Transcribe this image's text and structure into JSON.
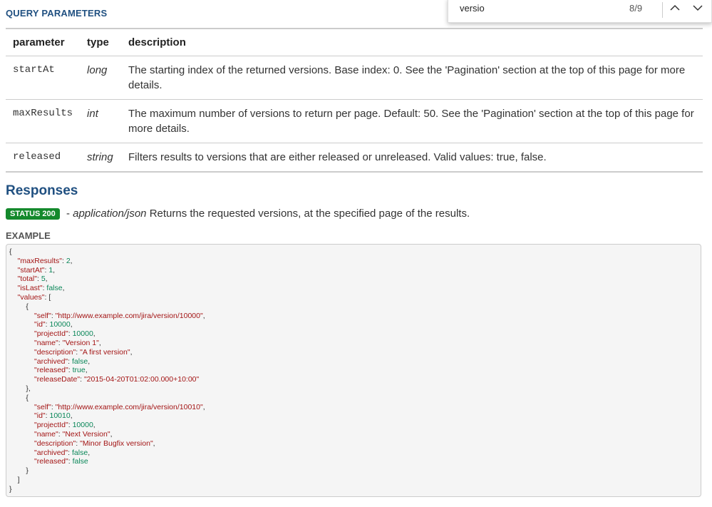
{
  "query_parameters": {
    "title": "QUERY PARAMETERS",
    "headers": {
      "parameter": "parameter",
      "type": "type",
      "description": "description"
    },
    "rows": [
      {
        "name": "startAt",
        "type": "long",
        "description": "The starting index of the returned versions. Base index: 0. See the 'Pagination' section at the top of this page for more details."
      },
      {
        "name": "maxResults",
        "type": "int",
        "description": "The maximum number of versions to return per page. Default: 50. See the 'Pagination' section at the top of this page for more details."
      },
      {
        "name": "released",
        "type": "string",
        "description": "Filters results to versions that are either released or unreleased. Valid values: true, false."
      }
    ]
  },
  "responses": {
    "title": "Responses",
    "status_badge": "STATUS 200",
    "separator": " - ",
    "mime": "application/json",
    "description": " Returns the requested versions, at the specified page of the results.",
    "example_label": "EXAMPLE"
  },
  "example_json": {
    "maxResults": 2,
    "startAt": 1,
    "total": 5,
    "isLast": false,
    "values": [
      {
        "self": "http://www.example.com/jira/version/10000",
        "id": 10000,
        "projectId": 10000,
        "name": "Version 1",
        "description": "A first version",
        "archived": false,
        "released": true,
        "releaseDate": "2015-04-20T01:02:00.000+10:00"
      },
      {
        "self": "http://www.example.com/jira/version/10010",
        "id": 10010,
        "projectId": 10000,
        "name": "Next Version",
        "description": "Minor Bugfix version",
        "archived": false,
        "released": false
      }
    ]
  },
  "find_bar": {
    "query": "versio",
    "match_count": "8/9",
    "prev_icon": "chevron-up-icon",
    "next_icon": "chevron-down-icon"
  },
  "colors": {
    "heading_blue": "#205081",
    "badge_green": "#14892c",
    "json_key": "#a31515",
    "json_value": "#098658"
  }
}
